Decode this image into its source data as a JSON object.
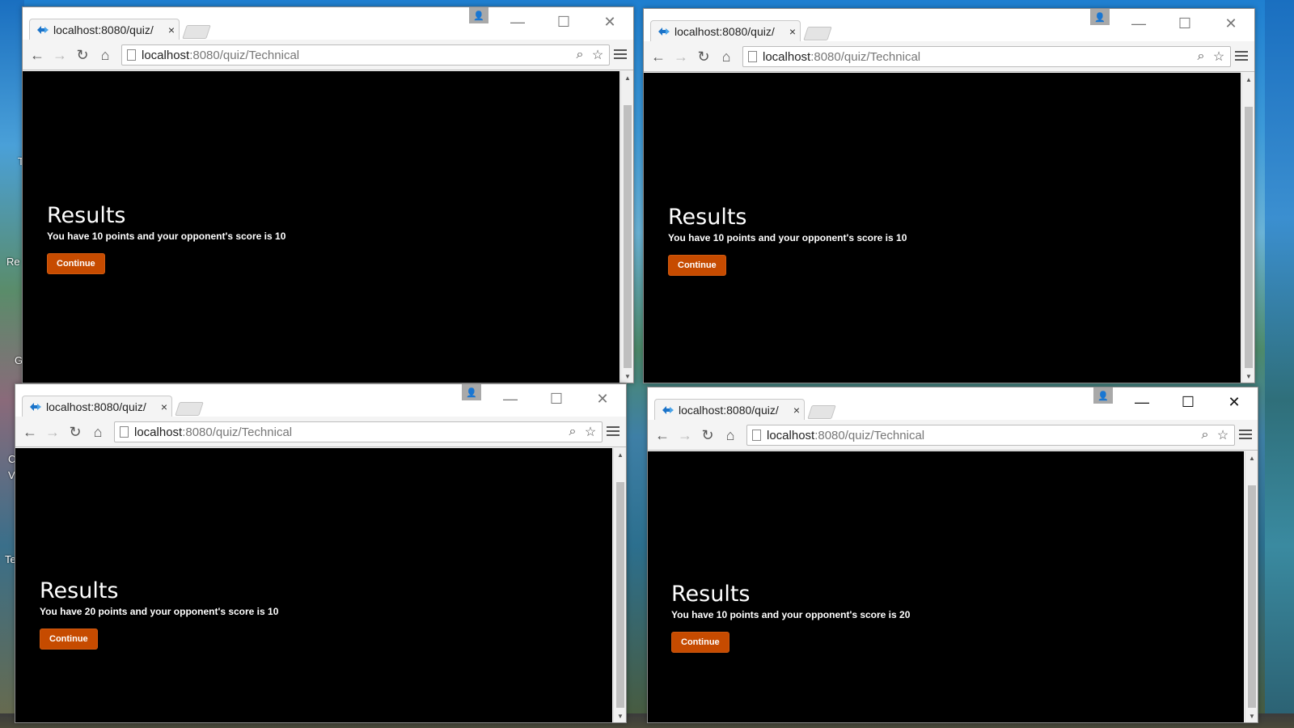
{
  "desktop": {
    "labels": [
      "T",
      "Re",
      "G",
      "C",
      "V",
      "Te"
    ]
  },
  "windows": [
    {
      "tab_title": "localhost:8080/quiz/",
      "url_host": "localhost",
      "url_path": ":8080/quiz/Technical",
      "results_title": "Results",
      "results_text": "You have 10 points and your opponent's score is 10",
      "continue_label": "Continue"
    },
    {
      "tab_title": "localhost:8080/quiz/",
      "url_host": "localhost",
      "url_path": ":8080/quiz/Technical",
      "results_title": "Results",
      "results_text": "You have 10 points and your opponent's score is 10",
      "continue_label": "Continue"
    },
    {
      "tab_title": "localhost:8080/quiz/",
      "url_host": "localhost",
      "url_path": ":8080/quiz/Technical",
      "results_title": "Results",
      "results_text": "You have 20 points and your opponent's score is 10",
      "continue_label": "Continue"
    },
    {
      "tab_title": "localhost:8080/quiz/",
      "url_host": "localhost",
      "url_path": ":8080/quiz/Technical",
      "results_title": "Results",
      "results_text": "You have 10 points and your opponent's score is 20",
      "continue_label": "Continue"
    }
  ],
  "icons": {
    "tab_close": "×",
    "back": "←",
    "forward": "→",
    "reload": "↻",
    "home": "⌂",
    "zoom": "⌕",
    "star": "☆",
    "minimize": "—",
    "maximize": "☐",
    "close": "✕",
    "profile": "👤",
    "scroll_up": "▲",
    "scroll_down": "▼"
  },
  "colors": {
    "continue_button": "#c64b00",
    "page_background": "#000000"
  }
}
